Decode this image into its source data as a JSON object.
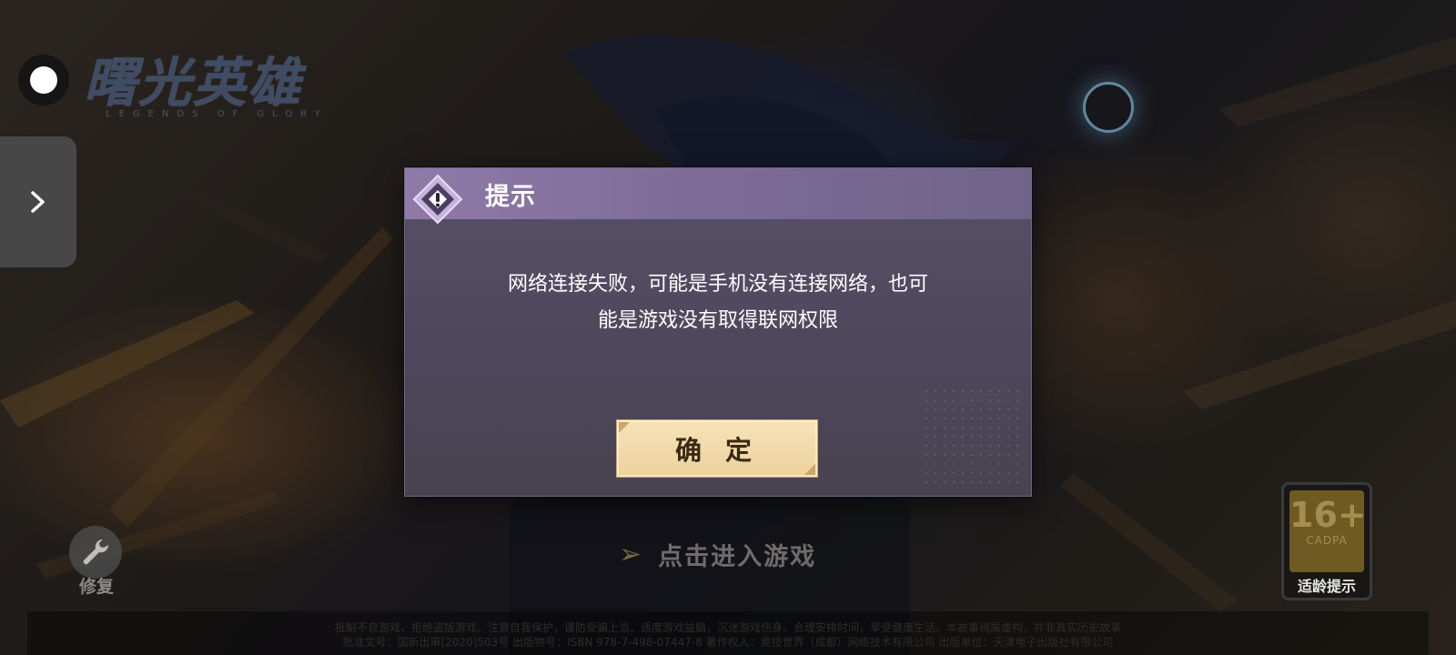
{
  "logo": {
    "title": "曙光英雄",
    "subtitle": "LEGENDS OF GLORY"
  },
  "dialog": {
    "title": "提示",
    "message_line1": "网络连接失败，可能是手机没有连接网络，也可",
    "message_line2": "能是游戏没有取得联网权限",
    "confirm_label": "确 定"
  },
  "enter_game": {
    "label": "点击进入游戏"
  },
  "repair": {
    "label": "修复"
  },
  "age_rating": {
    "number": "16+",
    "org": "CADPA",
    "label": "适龄提示"
  },
  "notice": {
    "line1": "抵制不良游戏，拒绝盗版游戏。注意自我保护，谨防受骗上当。适度游戏益脑，沉迷游戏伤身。合理安排时间，享受健康生活。本故事纯属虚构，并非真实历史故事",
    "line2": "批准文号：国新出审[2020]503号  出版物号：ISBN 978-7-498-07447-8  著作权人：竞技世界（成都）网络技术有限公司  出版单位：天津电子出版社有限公司"
  },
  "colors": {
    "dialog_header": "#8f7aa8",
    "dialog_body": "#575068",
    "confirm_button": "#f2dba9"
  }
}
